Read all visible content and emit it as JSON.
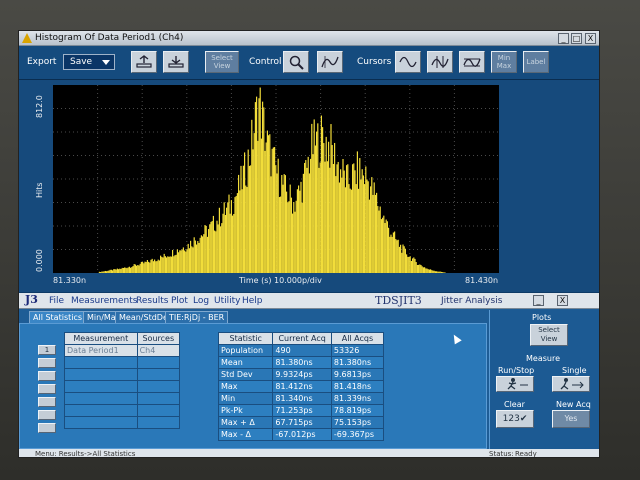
{
  "window": {
    "title": "Histogram Of Data Period1 (Ch4)",
    "controls": [
      "_",
      "□",
      "X"
    ]
  },
  "toolbar": {
    "export_label": "Export",
    "save_label": "Save",
    "select_view_label": "Select View",
    "control_label": "Control",
    "cursors_label": "Cursors",
    "minmax_label": "Min Max",
    "label_btn": "Label"
  },
  "chart_data": {
    "type": "bar",
    "title": "",
    "xlabel": "Time (s)",
    "scale_label": "10.000p/div",
    "ylabel": "Hits",
    "xlim_labels": [
      "81.330n",
      "81.430n"
    ],
    "ylim": [
      0.0,
      812.0
    ],
    "ytick_labels": [
      "0.000",
      "812.0"
    ],
    "xlim": [
      81.33,
      81.43
    ],
    "color": "#f2dd3a",
    "x": [
      81.34,
      81.345,
      81.35,
      81.355,
      81.36,
      81.365,
      81.37,
      81.372,
      81.374,
      81.376,
      81.378,
      81.38,
      81.382,
      81.384,
      81.386,
      81.388,
      81.39,
      81.392,
      81.394,
      81.396,
      81.398,
      81.4,
      81.402,
      81.404,
      81.406,
      81.408,
      81.41,
      81.412,
      81.414,
      81.416,
      81.418
    ],
    "values": [
      4,
      20,
      45,
      80,
      130,
      210,
      330,
      420,
      560,
      812,
      600,
      480,
      390,
      330,
      430,
      600,
      640,
      600,
      500,
      430,
      480,
      460,
      370,
      260,
      180,
      120,
      75,
      40,
      18,
      8,
      2
    ]
  },
  "app": {
    "logo": "J3",
    "menus": [
      "File",
      "Measurements",
      "Results",
      "Plot",
      "Log",
      "Utility",
      "Help"
    ],
    "title": "TDSJIT3",
    "subtitle": "Jitter Analysis",
    "tabs": [
      "All Statistics",
      "Min/Max",
      "Mean/StdDev",
      "TIE:RjDj - BER"
    ],
    "row_buttons": [
      "1",
      "",
      "",
      "",
      "",
      "",
      ""
    ],
    "measurements_headers": [
      "Measurement",
      "Sources"
    ],
    "measurements_rows": [
      [
        "Data Period1",
        "Ch4"
      ],
      [
        "",
        ""
      ],
      [
        "",
        ""
      ],
      [
        "",
        ""
      ],
      [
        "",
        ""
      ],
      [
        "",
        ""
      ],
      [
        "",
        ""
      ]
    ],
    "stats_headers": [
      "Statistic",
      "Current Acq",
      "All Acqs"
    ],
    "stats_rows": [
      [
        "Population",
        "490",
        "53326"
      ],
      [
        "Mean",
        "81.380ns",
        "81.380ns"
      ],
      [
        "Std Dev",
        "9.9324ps",
        "9.6813ps"
      ],
      [
        "Max",
        "81.412ns",
        "81.418ns"
      ],
      [
        "Min",
        "81.340ns",
        "81.339ns"
      ],
      [
        "Pk-Pk",
        "71.253ps",
        "78.819ps"
      ],
      [
        "Max + Δ",
        "67.715ps",
        "75.153ps"
      ],
      [
        "Max - Δ",
        "-67.012ps",
        "-69.367ps"
      ]
    ]
  },
  "right_panel": {
    "plots_label": "Plots",
    "select_view": "Select View",
    "measure_label": "Measure",
    "run_stop": "Run/Stop",
    "single": "Single",
    "clear": "Clear",
    "new_acq": "New Acq",
    "yes": "Yes",
    "clear_icon_text": "123"
  },
  "status": {
    "menu_path": "Menu: Results->All Statistics",
    "status_label": "Status:",
    "status_value": "Ready"
  }
}
